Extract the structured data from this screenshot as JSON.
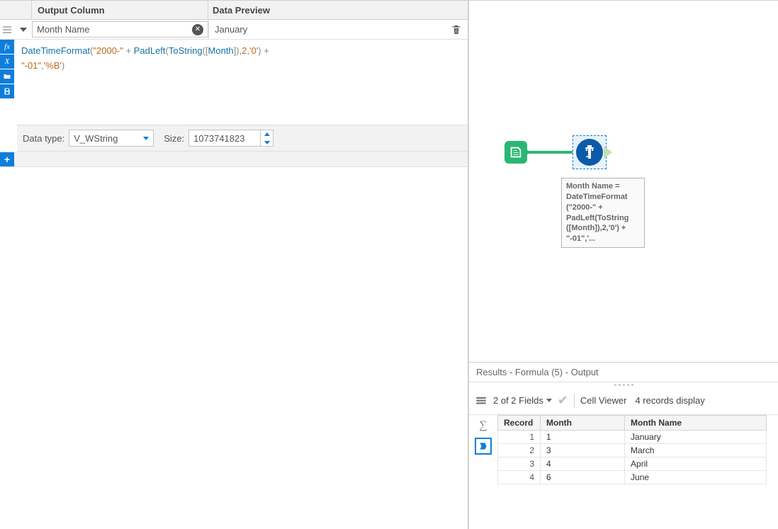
{
  "header": {
    "output": "Output Column",
    "preview": "Data Preview"
  },
  "row": {
    "output_column": "Month Name",
    "preview": "January"
  },
  "formula": {
    "tokens": [
      {
        "t": "fn",
        "v": "DateTimeFormat"
      },
      {
        "t": "op",
        "v": "("
      },
      {
        "t": "str",
        "v": "\"2000-\""
      },
      {
        "t": "op",
        "v": " + "
      },
      {
        "t": "fn",
        "v": "PadLeft"
      },
      {
        "t": "op",
        "v": "("
      },
      {
        "t": "fn",
        "v": "ToString"
      },
      {
        "t": "op",
        "v": "(["
      },
      {
        "t": "col",
        "v": "Month"
      },
      {
        "t": "op",
        "v": "]),"
      },
      {
        "t": "num",
        "v": "2"
      },
      {
        "t": "op",
        "v": ","
      },
      {
        "t": "str",
        "v": "'0'"
      },
      {
        "t": "op",
        "v": ") + "
      },
      {
        "t": "br",
        "v": "\n"
      },
      {
        "t": "str",
        "v": "\"-01\""
      },
      {
        "t": "op",
        "v": ","
      },
      {
        "t": "str",
        "v": "'%B'"
      },
      {
        "t": "op",
        "v": ")"
      }
    ]
  },
  "datatype": {
    "label": "Data type:",
    "value": "V_WString",
    "size_label": "Size:",
    "size_value": "1073741823"
  },
  "annotation": {
    "line1": "Month Name =",
    "line2": "DateTimeFormat",
    "line3": "(\"2000-\" +",
    "line4": "PadLeft(ToString",
    "line5": "([Month]),2,'0') +",
    "line6": "\"-01\",'..."
  },
  "results": {
    "title": "Results - Formula (5) - Output",
    "fields": "2 of 2 Fields",
    "cell_viewer": "Cell Viewer",
    "records": "4 records display",
    "columns": [
      "Record",
      "Month",
      "Month Name"
    ],
    "rows": [
      {
        "rec": "1",
        "month": "1",
        "name": "January"
      },
      {
        "rec": "2",
        "month": "3",
        "name": "March"
      },
      {
        "rec": "3",
        "month": "4",
        "name": "April"
      },
      {
        "rec": "4",
        "month": "6",
        "name": "June"
      }
    ]
  }
}
